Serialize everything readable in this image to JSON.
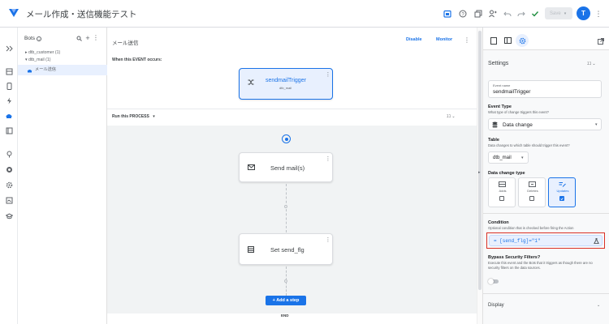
{
  "app": {
    "title": "メール作成・送信機能テスト",
    "avatar_letter": "T",
    "save_label": "Save"
  },
  "bots_panel": {
    "header": "Bots",
    "tree": [
      {
        "label": "▸ dtb_customer (1)"
      },
      {
        "label": "▾ dtb_mail (1)"
      },
      {
        "label": "メール送信",
        "selected": true
      }
    ]
  },
  "main": {
    "title": "メール送信",
    "disable_label": "Disable",
    "monitor_label": "Monitor",
    "event_section_label": "When this EVENT occurs:",
    "trigger_card": {
      "title": "sendmailTrigger",
      "subtitle": "dtb_mail"
    },
    "process_section_label": "Run this PROCESS",
    "process_badge": "ﾕｺ",
    "steps": [
      {
        "title": "Send mail(s)"
      },
      {
        "title": "Set send_flg"
      }
    ],
    "add_step_label": "+ Add a step",
    "end_label": "END"
  },
  "settings": {
    "tabs": [
      "settings-tab",
      "table-view-tab",
      "gear-tab"
    ],
    "panel_title": "Settings",
    "panel_badge": "ﾕｺ",
    "event_name_label": "Event name",
    "event_name_value": "sendmailTrigger",
    "event_type_title": "Event Type",
    "event_type_desc": "What type of change triggers this event?",
    "event_type_value": "Data change",
    "table_title": "Table",
    "table_desc": "Data changes to which table should trigger this event?",
    "table_value": "dtb_mail",
    "data_change_title": "Data change type",
    "change_types": [
      {
        "label": "Adds",
        "checked": false
      },
      {
        "label": "Deletes",
        "checked": false
      },
      {
        "label": "Updates",
        "checked": true
      }
    ],
    "condition_title": "Condition",
    "condition_desc": "Optional condition that is checked before firing the Action",
    "condition_value": "= [send_flg]=\"1\"",
    "bypass_title": "Bypass Security Filters?",
    "bypass_desc": "Execute this event and the Bots that it triggers as though there are no security filters on the data sources.",
    "display_label": "Display"
  },
  "colors": {
    "accent": "#1a73e8",
    "highlight_border": "#d93025",
    "selected_bg": "#e8f0fe"
  }
}
